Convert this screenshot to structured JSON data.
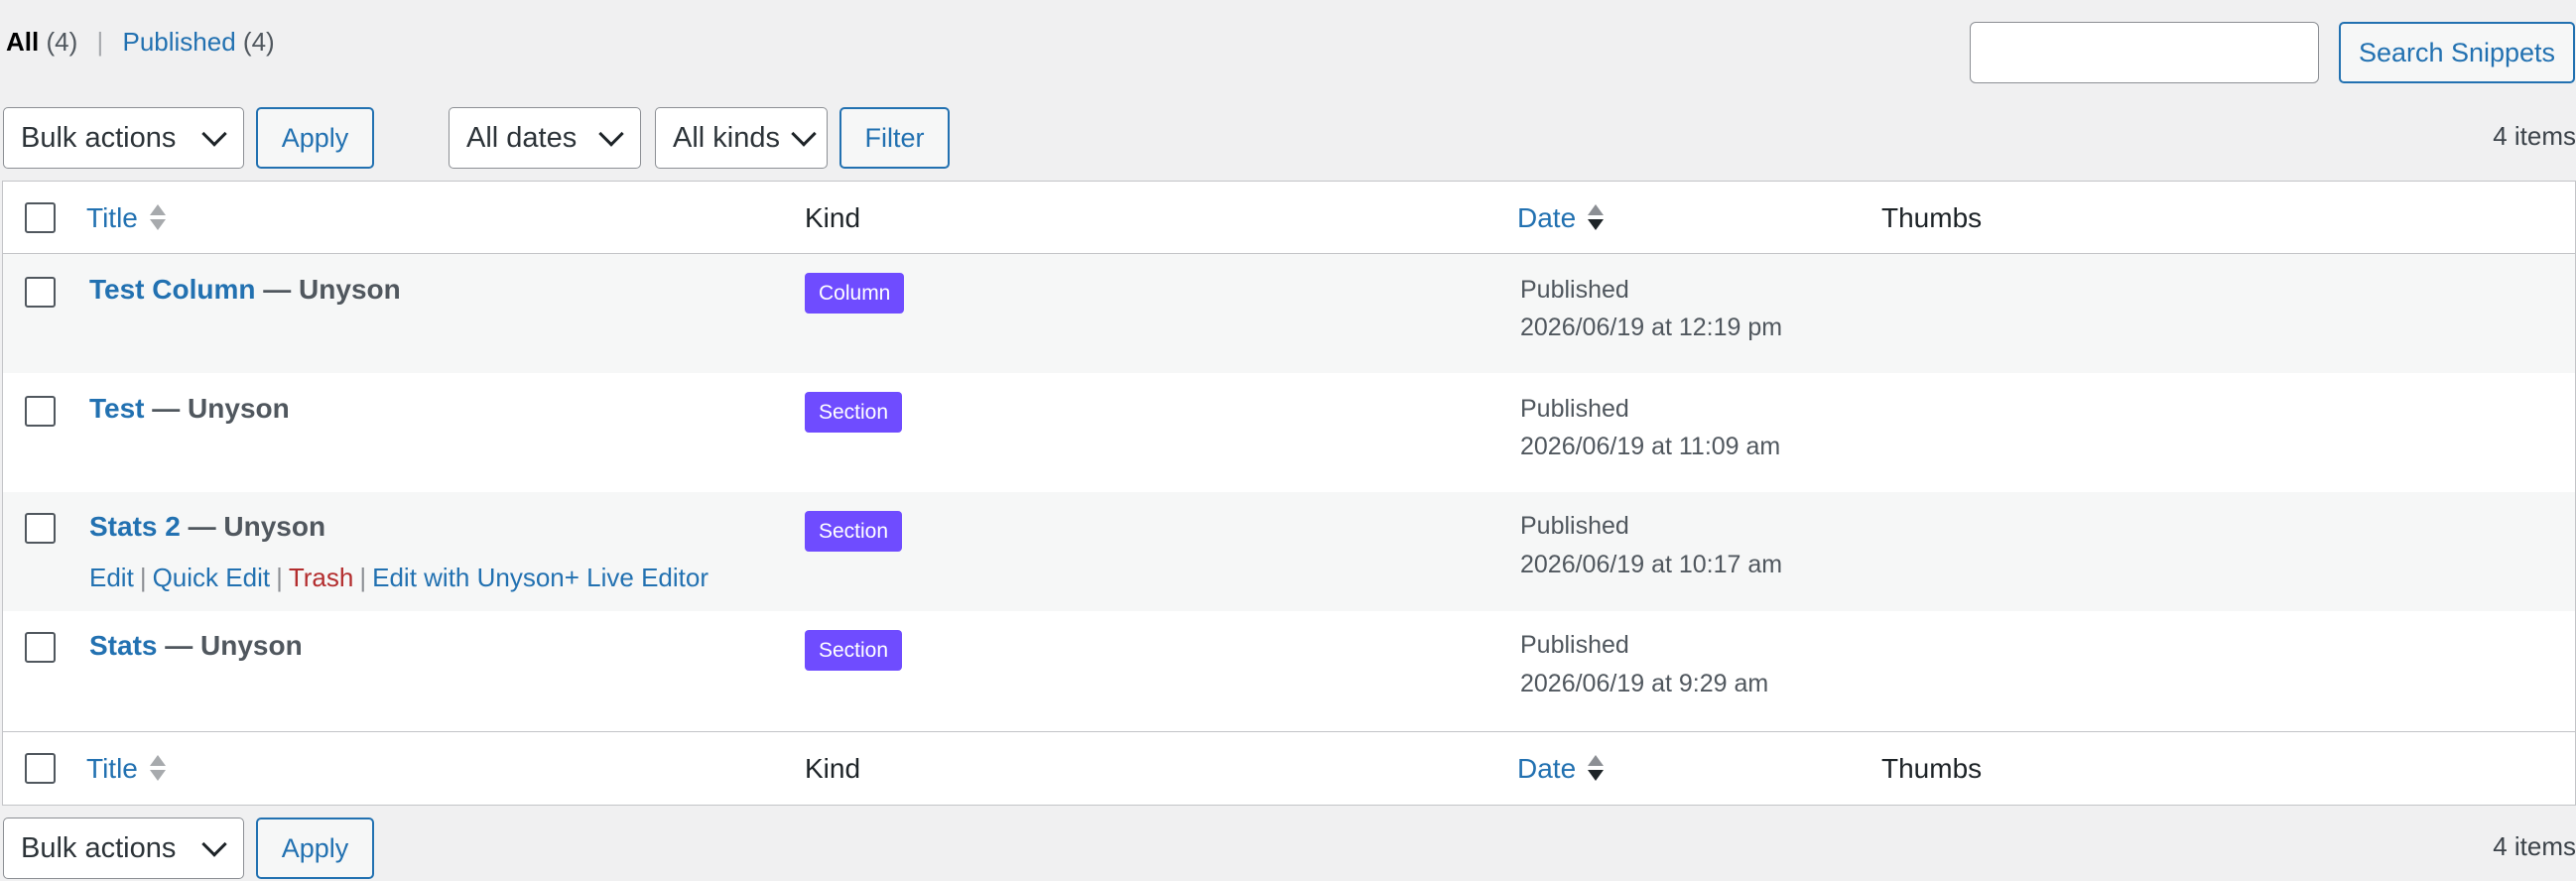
{
  "views": {
    "all_label": "All",
    "all_count": "(4)",
    "separator": "|",
    "published_label": "Published",
    "published_count": "(4)"
  },
  "search": {
    "placeholder": "",
    "button_label": "Search Snippets"
  },
  "top_nav": {
    "bulk_actions": "Bulk actions",
    "apply_label": "Apply",
    "dates_filter": "All dates",
    "kinds_filter": "All kinds",
    "filter_label": "Filter",
    "items_count": "4 items"
  },
  "columns": {
    "title": "Title",
    "kind": "Kind",
    "date": "Date",
    "thumbs": "Thumbs"
  },
  "rows": [
    {
      "title": "Test Column",
      "suffix": "— Unyson",
      "kind": "Column",
      "status": "Published",
      "date": "2026/06/19 at 12:19 pm"
    },
    {
      "title": "Test",
      "suffix": "— Unyson",
      "kind": "Section",
      "status": "Published",
      "date": "2026/06/19 at 11:09 am"
    },
    {
      "title": "Stats 2",
      "suffix": "— Unyson",
      "kind": "Section",
      "status": "Published",
      "date": "2026/06/19 at 10:17 am",
      "actions": {
        "edit": "Edit",
        "quick_edit": "Quick Edit",
        "trash": "Trash",
        "live_editor": "Edit with Unyson+ Live Editor",
        "separator": "|"
      }
    },
    {
      "title": "Stats",
      "suffix": "— Unyson",
      "kind": "Section",
      "status": "Published",
      "date": "2026/06/19 at 9:29 am"
    }
  ],
  "bottom_nav": {
    "bulk_actions": "Bulk actions",
    "apply_label": "Apply",
    "items_count": "4 items"
  },
  "colors": {
    "accent": "#2271b1",
    "badge": "#6f4cff",
    "trash": "#b32d2e",
    "background": "#f0f0f1"
  }
}
